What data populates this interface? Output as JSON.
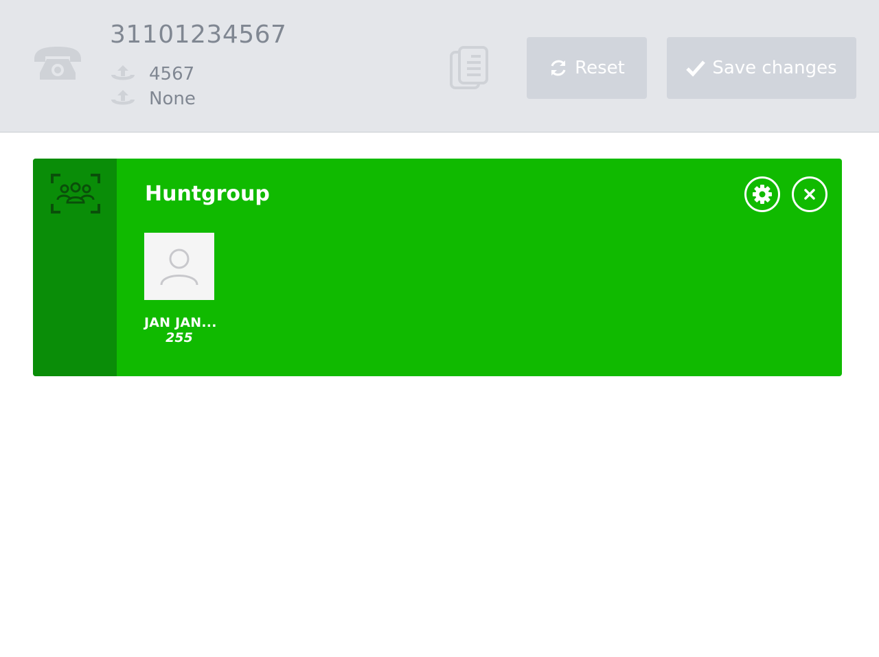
{
  "header": {
    "number": "31101234567",
    "rows": [
      {
        "icon": "outgoing-call-icon",
        "value": "4567"
      },
      {
        "icon": "outgoing-call-icon",
        "value": "None"
      }
    ],
    "reset_label": "Reset",
    "save_label": "Save changes"
  },
  "group": {
    "title": "Huntgroup",
    "accent_color": "#10ba00",
    "side_color": "#0a8d08",
    "members": [
      {
        "name": "JAN JAN...",
        "extension": "255"
      }
    ]
  }
}
